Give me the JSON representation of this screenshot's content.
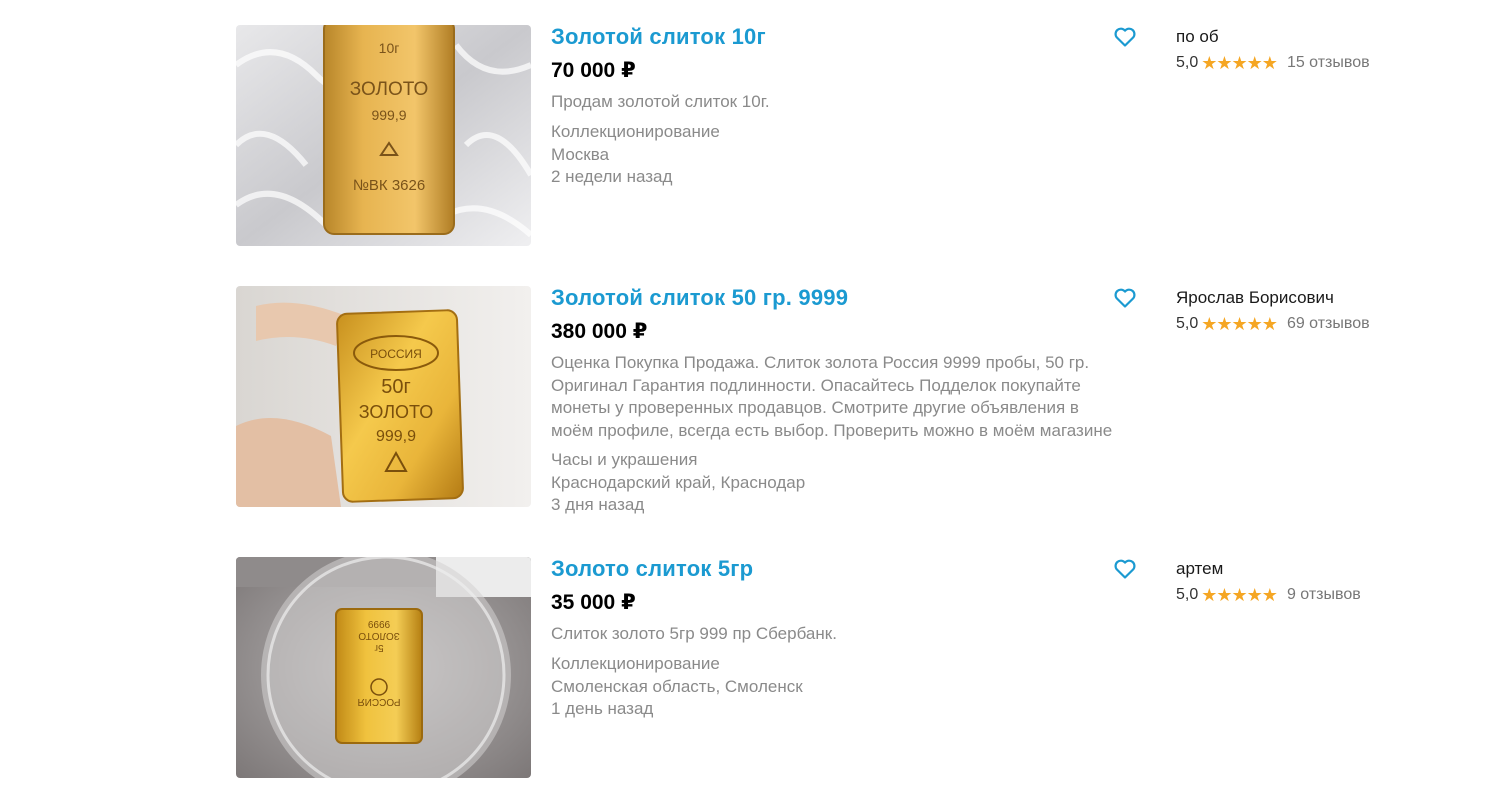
{
  "listings": [
    {
      "title": "Золотой слиток 10г",
      "price": "70 000 ₽",
      "description": "Продам золотой слиток 10г.",
      "category": "Коллекционирование",
      "location": "Москва",
      "posted": "2 недели назад",
      "seller": {
        "name": "по об",
        "rating": "5,0",
        "stars": "★★★★★",
        "reviews": "15 отзывов"
      },
      "photo": {
        "bar_marks": [
          "10г",
          "ЗОЛОТО",
          "999,9",
          "№ВК 3626"
        ]
      }
    },
    {
      "title": "Золотой слиток 50 гр. 9999",
      "price": "380 000 ₽",
      "description": "Оценка Покупка Продажа. Слиток золота Россия 9999 пробы, 50 гр. Оригинал Гарантия подлинности. Опасайтесь Подделок покупайте монеты у проверенных продавцов. Смотрите другие объявления в моём профиле, всегда есть выбор. Проверить можно в моём магазине",
      "category": "Часы и украшения",
      "location": "Краснодарский край, Краснодар",
      "posted": "3 дня назад",
      "seller": {
        "name": "Ярослав Борисович",
        "rating": "5,0",
        "stars": "★★★★★",
        "reviews": "69 отзывов"
      },
      "photo": {
        "bar_marks": [
          "РОССИЯ",
          "50г",
          "ЗОЛОТО",
          "999,9"
        ]
      }
    },
    {
      "title": "Золото слиток 5гр",
      "price": "35 000 ₽",
      "description": "Слиток золото 5гр 999 пр Сбербанк.",
      "category": "Коллекционирование",
      "location": "Смоленская область, Смоленск",
      "posted": "1 день назад",
      "seller": {
        "name": "артем",
        "rating": "5,0",
        "stars": "★★★★★",
        "reviews": "9 отзывов"
      },
      "photo": {
        "bar_marks": [
          "5г",
          "ЗОЛОТО",
          "9999",
          "РОССИЯ"
        ]
      }
    }
  ],
  "colors": {
    "title": "#1b9ad1",
    "star": "#f5a623",
    "muted": "#8a8a8a",
    "gold": "#d9a632"
  },
  "icons": {
    "favorite": "heart-outline-icon"
  }
}
